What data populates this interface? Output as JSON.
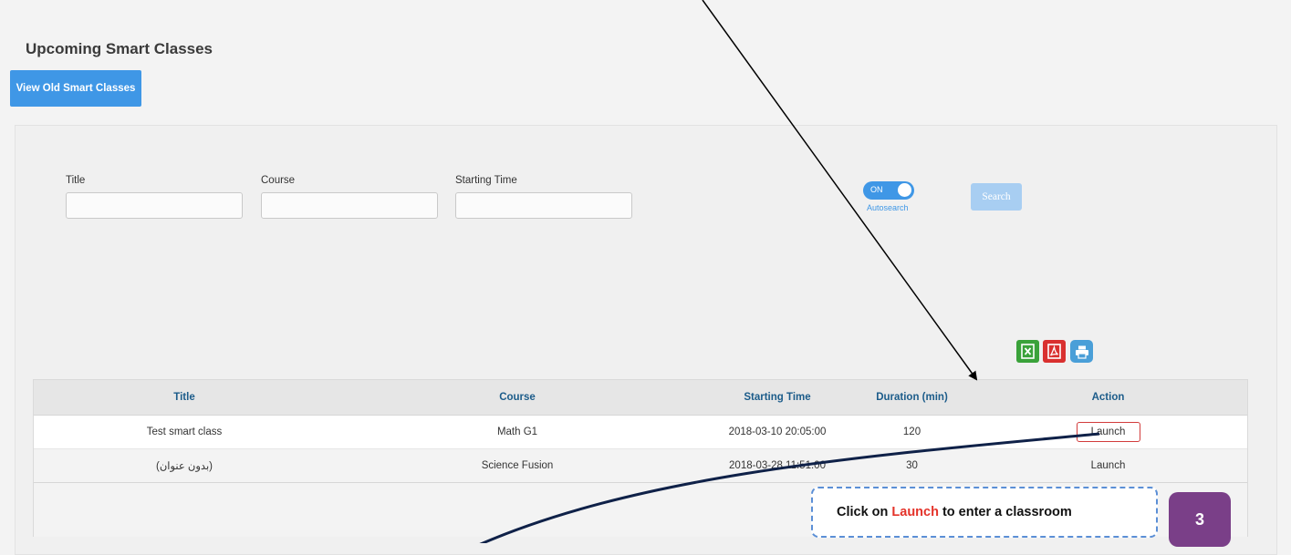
{
  "page": {
    "title": "Upcoming Smart Classes",
    "old_classes_button": "View Old Smart Classes"
  },
  "filters": {
    "title_label": "Title",
    "course_label": "Course",
    "starting_time_label": "Starting Time",
    "title_value": "",
    "course_value": "",
    "starting_time_value": ""
  },
  "autosearch": {
    "toggle_state": "ON",
    "label": "Autosearch"
  },
  "search_button": "Search",
  "export": {
    "excel_icon": "excel-file-icon",
    "pdf_icon": "pdf-file-icon",
    "print_icon": "printer-icon",
    "colors": {
      "excel": "#3aa23a",
      "pdf": "#d9302f",
      "print": "#4a9fd8"
    }
  },
  "table": {
    "headers": [
      "Title",
      "Course",
      "Starting Time",
      "Duration (min)",
      "Action"
    ],
    "rows": [
      {
        "title": "Test smart class",
        "course": "Math G1",
        "starting_time": "2018-03-10 20:05:00",
        "duration": "120",
        "action": "Launch"
      },
      {
        "title": "(بدون عنوان)",
        "course": "Science Fusion",
        "starting_time": "2018-03-28 11:51:00",
        "duration": "30",
        "action": "Launch"
      }
    ]
  },
  "annotation": {
    "prefix": "Click on",
    "highlight": "Launch",
    "suffix": "to enter a classroom",
    "step_number": "3",
    "highlight_color": "#e4332a",
    "badge_color": "#7a3f88"
  }
}
